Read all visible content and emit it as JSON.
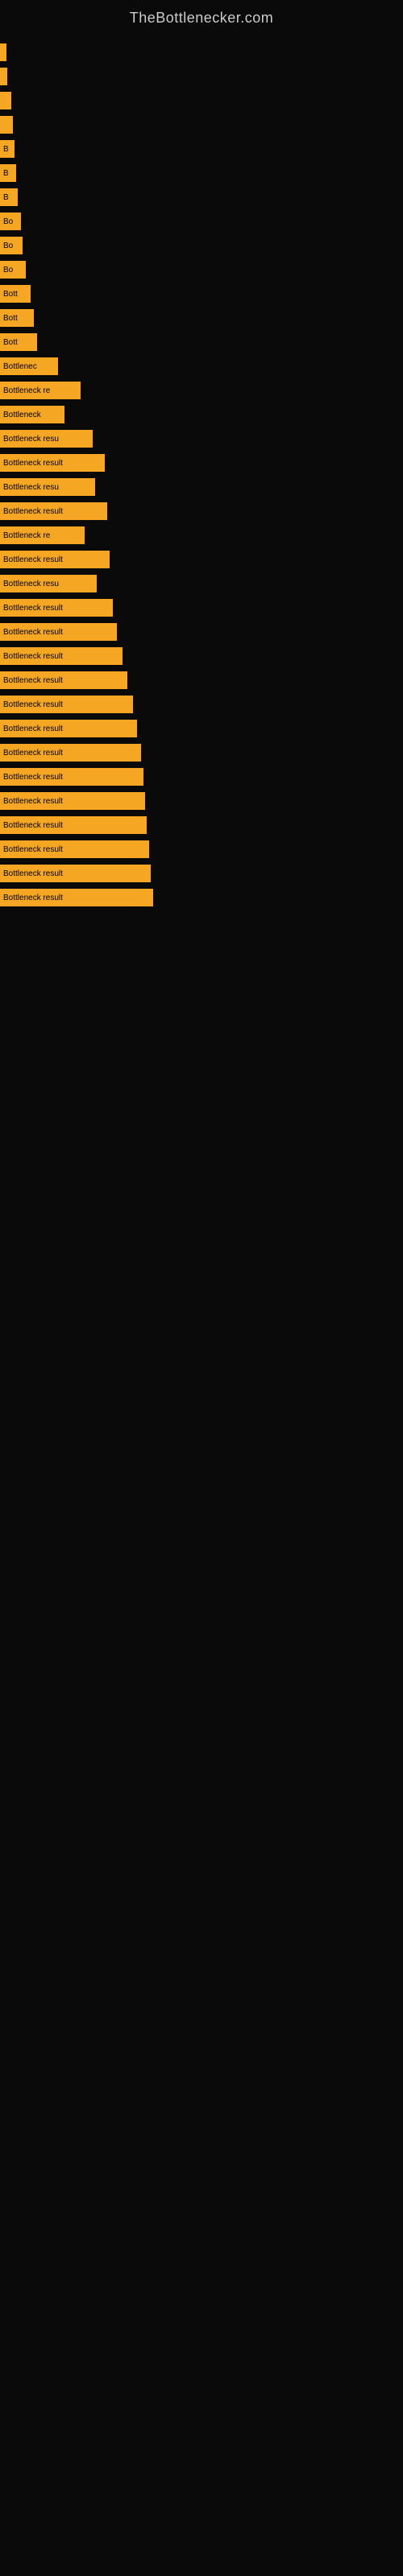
{
  "site": {
    "title": "TheBottlenecker.com"
  },
  "bars": [
    {
      "label": "",
      "width": 8,
      "text": ""
    },
    {
      "label": "",
      "width": 9,
      "text": ""
    },
    {
      "label": "",
      "width": 14,
      "text": ""
    },
    {
      "label": "",
      "width": 16,
      "text": ""
    },
    {
      "label": "B",
      "width": 18,
      "text": "B"
    },
    {
      "label": "B",
      "width": 20,
      "text": "B"
    },
    {
      "label": "B",
      "width": 22,
      "text": "B"
    },
    {
      "label": "Bo",
      "width": 26,
      "text": "Bo"
    },
    {
      "label": "Bo",
      "width": 28,
      "text": "Bo"
    },
    {
      "label": "Bo",
      "width": 32,
      "text": "Bo"
    },
    {
      "label": "Bott",
      "width": 38,
      "text": "Bott"
    },
    {
      "label": "Bott",
      "width": 42,
      "text": "Bott"
    },
    {
      "label": "Bott",
      "width": 46,
      "text": "Bott"
    },
    {
      "label": "Bottlenec",
      "width": 72,
      "text": "Bottlenec"
    },
    {
      "label": "Bottleneck re",
      "width": 100,
      "text": "Bottleneck re"
    },
    {
      "label": "Bottleneck",
      "width": 80,
      "text": "Bottleneck"
    },
    {
      "label": "Bottleneck resu",
      "width": 115,
      "text": "Bottleneck resu"
    },
    {
      "label": "Bottleneck result",
      "width": 130,
      "text": "Bottleneck result"
    },
    {
      "label": "Bottleneck resu",
      "width": 118,
      "text": "Bottleneck resu"
    },
    {
      "label": "Bottleneck result",
      "width": 133,
      "text": "Bottleneck result"
    },
    {
      "label": "Bottleneck re",
      "width": 105,
      "text": "Bottleneck re"
    },
    {
      "label": "Bottleneck result",
      "width": 136,
      "text": "Bottleneck result"
    },
    {
      "label": "Bottleneck resu",
      "width": 120,
      "text": "Bottleneck resu"
    },
    {
      "label": "Bottleneck result",
      "width": 140,
      "text": "Bottleneck result"
    },
    {
      "label": "Bottleneck result",
      "width": 145,
      "text": "Bottleneck result"
    },
    {
      "label": "Bottleneck result",
      "width": 152,
      "text": "Bottleneck result"
    },
    {
      "label": "Bottleneck result",
      "width": 158,
      "text": "Bottleneck result"
    },
    {
      "label": "Bottleneck result",
      "width": 165,
      "text": "Bottleneck result"
    },
    {
      "label": "Bottleneck result",
      "width": 170,
      "text": "Bottleneck result"
    },
    {
      "label": "Bottleneck result",
      "width": 175,
      "text": "Bottleneck result"
    },
    {
      "label": "Bottleneck result",
      "width": 178,
      "text": "Bottleneck result"
    },
    {
      "label": "Bottleneck result",
      "width": 180,
      "text": "Bottleneck result"
    },
    {
      "label": "Bottleneck result",
      "width": 182,
      "text": "Bottleneck result"
    },
    {
      "label": "Bottleneck result",
      "width": 185,
      "text": "Bottleneck result"
    },
    {
      "label": "Bottleneck result",
      "width": 187,
      "text": "Bottleneck result"
    },
    {
      "label": "Bottleneck result",
      "width": 190,
      "text": "Bottleneck result"
    }
  ]
}
